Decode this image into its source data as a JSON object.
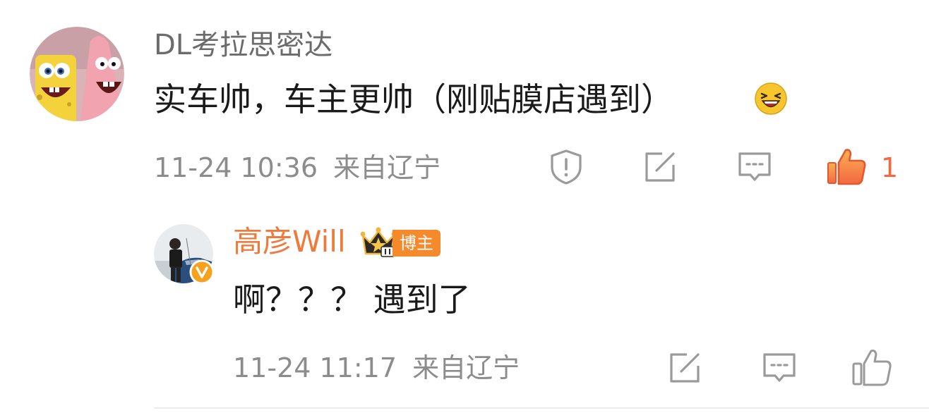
{
  "comment": {
    "username": "DL考拉思密达",
    "text": "实车帅，车主更帅（刚贴膜店遇到）",
    "emoji": "laughing-emoji",
    "timestamp": "11-24 10:36",
    "location": "来自辽宁",
    "like_count": "1",
    "avatar_icon": "spongebob-patrick-avatar"
  },
  "reply": {
    "username": "高彦Will",
    "badge_label": "博主",
    "text": "啊？？？ 遇到了",
    "timestamp": "11-24 11:17",
    "location": "来自辽宁",
    "avatar_icon": "person-with-car-avatar",
    "verified_icon": "verified-v-icon"
  },
  "colors": {
    "username_reply": "#ee7a3c",
    "like_active": "#f3683f",
    "badge_bg": "#f58a2d",
    "meta_text": "#8c8c8c",
    "icon_stroke": "#9a9a9a"
  }
}
